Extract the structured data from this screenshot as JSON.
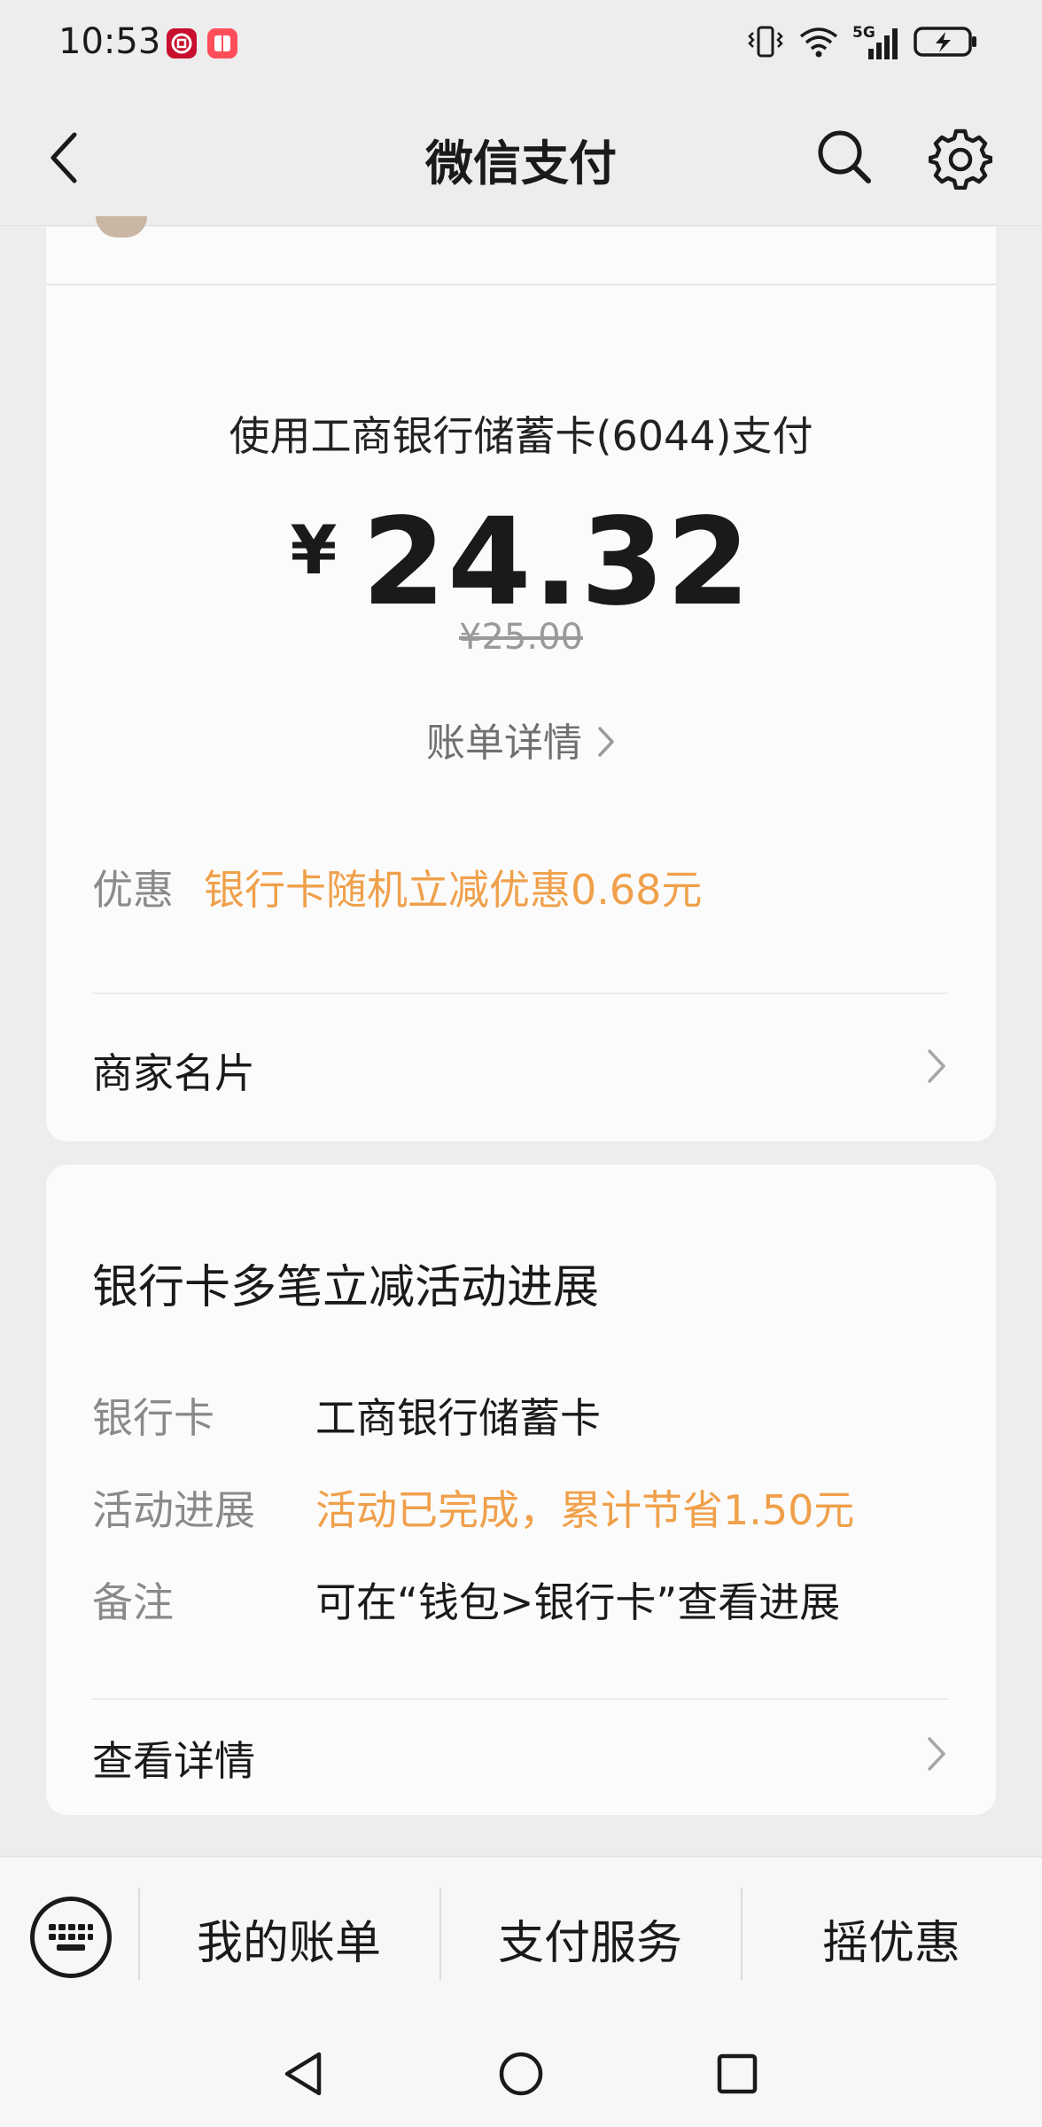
{
  "status_bar": {
    "time": "10:53",
    "app_icons": [
      "bank-app-icon",
      "notes-app-icon"
    ],
    "indicators": [
      "vibrate-icon",
      "wifi-icon",
      "5g-signal-icon",
      "battery-charging-icon"
    ],
    "network_label": "5G"
  },
  "nav": {
    "title": "微信支付"
  },
  "payment": {
    "method": "使用工商银行储蓄卡(6044)支付",
    "currency": "¥",
    "amount": "24.32",
    "original_amount": "¥25.00",
    "bill_detail_label": "账单详情"
  },
  "discount": {
    "label": "优惠",
    "value": "银行卡随机立减优惠0.68元"
  },
  "merchant_card": {
    "label": "商家名片"
  },
  "activity": {
    "title": "银行卡多笔立减活动进展",
    "rows": [
      {
        "label": "银行卡",
        "value": "工商银行储蓄卡",
        "highlight": false
      },
      {
        "label": "活动进展",
        "value": "活动已完成，累计节省1.50元",
        "highlight": true
      },
      {
        "label": "备注",
        "value": "可在“钱包>银行卡”查看进展",
        "highlight": false
      }
    ],
    "details_label": "查看详情"
  },
  "bottom_tabs": [
    "我的账单",
    "支付服务",
    "摇优惠"
  ],
  "colors": {
    "accent_orange": "#f0a04b",
    "background": "#ededed",
    "card": "#fbfbfb"
  }
}
